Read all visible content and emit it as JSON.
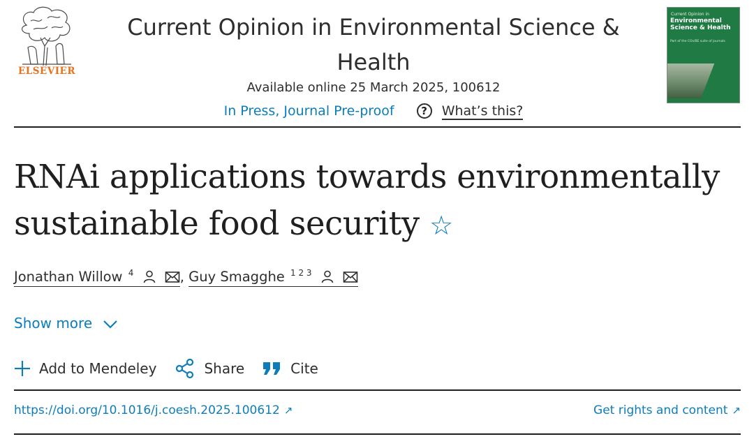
{
  "header": {
    "publisher": "ELSEVIER",
    "journal_title": "Current Opinion in Environmental Science & Health",
    "availability": "Available online 25 March 2025, 100612",
    "status_link": "In Press, Journal Pre-proof",
    "whats_this": "What’s this?",
    "cover": {
      "small_text": "Current Opinion in",
      "title": "Environmental Science & Health",
      "subtitle": "Part of the COs/BE suite of journals"
    }
  },
  "article": {
    "title": "RNAi applications towards environmentally sustainable food security",
    "star_icon": "star-outline-icon",
    "authors": [
      {
        "name": "Jonathan Willow",
        "sup": "4"
      },
      {
        "name": "Guy Smagghe",
        "sup": "1 2 3"
      }
    ],
    "separator": ",",
    "show_more": "Show more"
  },
  "actions": {
    "mendeley": "Add to Mendeley",
    "share": "Share",
    "cite": "Cite"
  },
  "links": {
    "doi": "https://doi.org/10.1016/j.coesh.2025.100612",
    "rights": "Get rights and content",
    "arrow": "↗"
  },
  "colors": {
    "link_blue": "#0c7dbb",
    "elsevier_orange": "#e9711c",
    "cover_green": "#1f7a43"
  }
}
